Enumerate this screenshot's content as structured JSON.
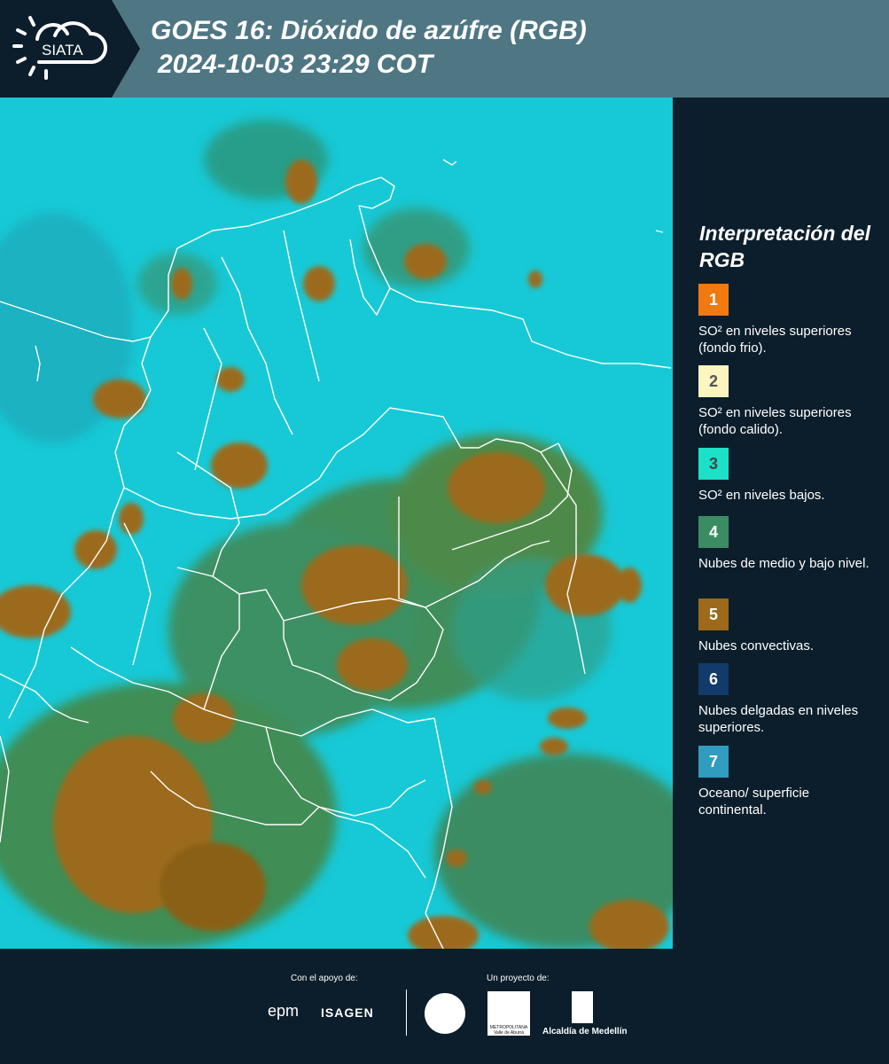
{
  "header": {
    "logo_text": "SIATA",
    "title_line1": "GOES 16: Dióxido de azúfre (RGB)",
    "title_line2": "2024-10-03 23:29 COT"
  },
  "colors": {
    "header_bg": "#4f7683",
    "panel_bg": "#0c1e2b",
    "map_base": "#17c9d6",
    "border_lines": "#ffffff"
  },
  "legend": {
    "title": "Interpretación del RGB",
    "items": [
      {
        "num": "1",
        "color": "#f07a10",
        "num_color": "#ffffff",
        "text": "SO² en niveles superiores (fondo frio)."
      },
      {
        "num": "2",
        "color": "#fdf5c0",
        "num_color": "#555555",
        "text": "SO² en niveles superiores (fondo calido)."
      },
      {
        "num": "3",
        "color": "#1de0c8",
        "num_color": "#444444",
        "text": "SO² en niveles bajos."
      },
      {
        "num": "4",
        "color": "#3a8c63",
        "num_color": "#ffffff",
        "text": "Nubes de medio y bajo nivel."
      },
      {
        "num": "5",
        "color": "#9c6a1a",
        "num_color": "#ffffff",
        "text": "Nubes convectivas."
      },
      {
        "num": "6",
        "color": "#123a6b",
        "num_color": "#ffffff",
        "text": "Nubes delgadas en niveles superiores."
      },
      {
        "num": "7",
        "color": "#2f9cc0",
        "num_color": "#ffffff",
        "text": "Oceano/ superficie continental."
      }
    ]
  },
  "footer": {
    "support_label": "Con el apoyo de:",
    "project_label": "Un proyecto de:",
    "epm": "epm",
    "isagen": "ISAGEN",
    "area_text": "METROPOLITANA Valle de Aburrá",
    "alcaldia": "Alcaldía de Medellín"
  }
}
